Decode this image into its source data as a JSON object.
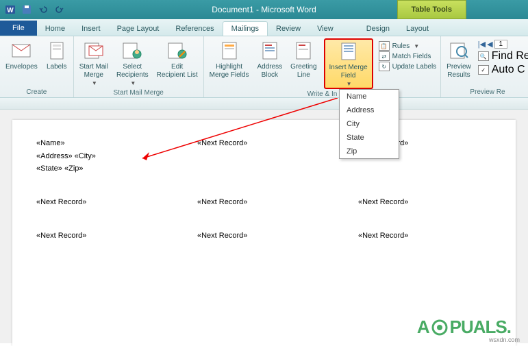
{
  "title": "Document1 - Microsoft Word",
  "context_tab": "Table Tools",
  "tabs": {
    "file": "File",
    "home": "Home",
    "insert": "Insert",
    "page_layout": "Page Layout",
    "references": "References",
    "mailings": "Mailings",
    "review": "Review",
    "view": "View",
    "design": "Design",
    "layout": "Layout"
  },
  "ribbon": {
    "create": {
      "label": "Create",
      "envelopes": "Envelopes",
      "labels": "Labels"
    },
    "start": {
      "label": "Start Mail Merge",
      "start_merge": "Start Mail\nMerge",
      "select_recipients": "Select\nRecipients",
      "edit_list": "Edit\nRecipient List"
    },
    "write": {
      "label": "Write & In",
      "highlight": "Highlight\nMerge Fields",
      "address": "Address\nBlock",
      "greeting": "Greeting\nLine",
      "insert_field": "Insert Merge\nField",
      "rules": "Rules",
      "match": "Match Fields",
      "update": "Update Labels"
    },
    "preview": {
      "label": "Preview Re",
      "preview_results": "Preview\nResults",
      "find": "Find Re",
      "auto": "Auto C"
    }
  },
  "dropdown": {
    "name": "Name",
    "address": "Address",
    "city": "City",
    "state": "State",
    "zip": "Zip"
  },
  "doc": {
    "field_name": "«Name»",
    "field_address": "«Address»",
    "field_city": "«City»",
    "field_state": "«State»",
    "field_zip": "«Zip»",
    "next_record": "«Next Record»"
  },
  "watermark": {
    "a": "A",
    "puals": "PUALS.",
    "src": "wsxdn.com"
  }
}
